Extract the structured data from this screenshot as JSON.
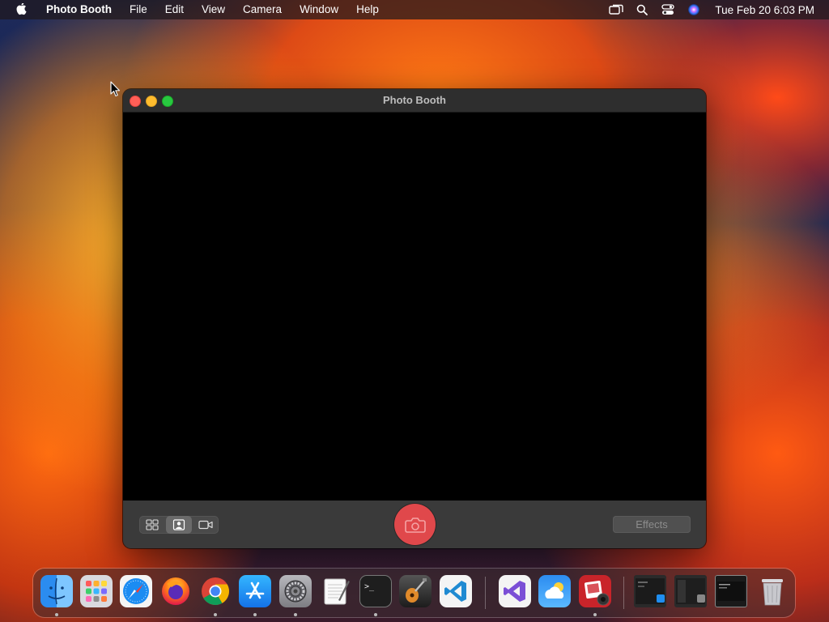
{
  "menubar": {
    "app_name": "Photo Booth",
    "menus": [
      "File",
      "Edit",
      "View",
      "Camera",
      "Window",
      "Help"
    ],
    "clock": "Tue Feb 20  6:03 PM"
  },
  "window": {
    "title": "Photo Booth",
    "effects_label": "Effects",
    "selected_mode": "single-photo"
  },
  "colors": {
    "shutter": "#e0484b",
    "close": "#ff5f57",
    "minimize": "#febc2e",
    "maximize": "#28c840"
  },
  "dock": {
    "apps": [
      {
        "icon": "finder-icon",
        "running": true
      },
      {
        "icon": "launchpad-icon",
        "running": false
      },
      {
        "icon": "safari-icon",
        "running": false
      },
      {
        "icon": "firefox-icon",
        "running": false
      },
      {
        "icon": "chrome-icon",
        "running": true
      },
      {
        "icon": "app-store-icon",
        "running": true
      },
      {
        "icon": "system-settings-icon",
        "running": true
      },
      {
        "icon": "textedit-icon",
        "running": false
      },
      {
        "icon": "terminal-icon",
        "running": true
      },
      {
        "icon": "garageband-icon",
        "running": false
      },
      {
        "icon": "vscode-icon",
        "running": false
      },
      {
        "icon": "visual-studio-icon",
        "running": false
      },
      {
        "icon": "weather-icon",
        "running": false
      },
      {
        "icon": "photo-booth-icon",
        "running": true
      }
    ]
  }
}
